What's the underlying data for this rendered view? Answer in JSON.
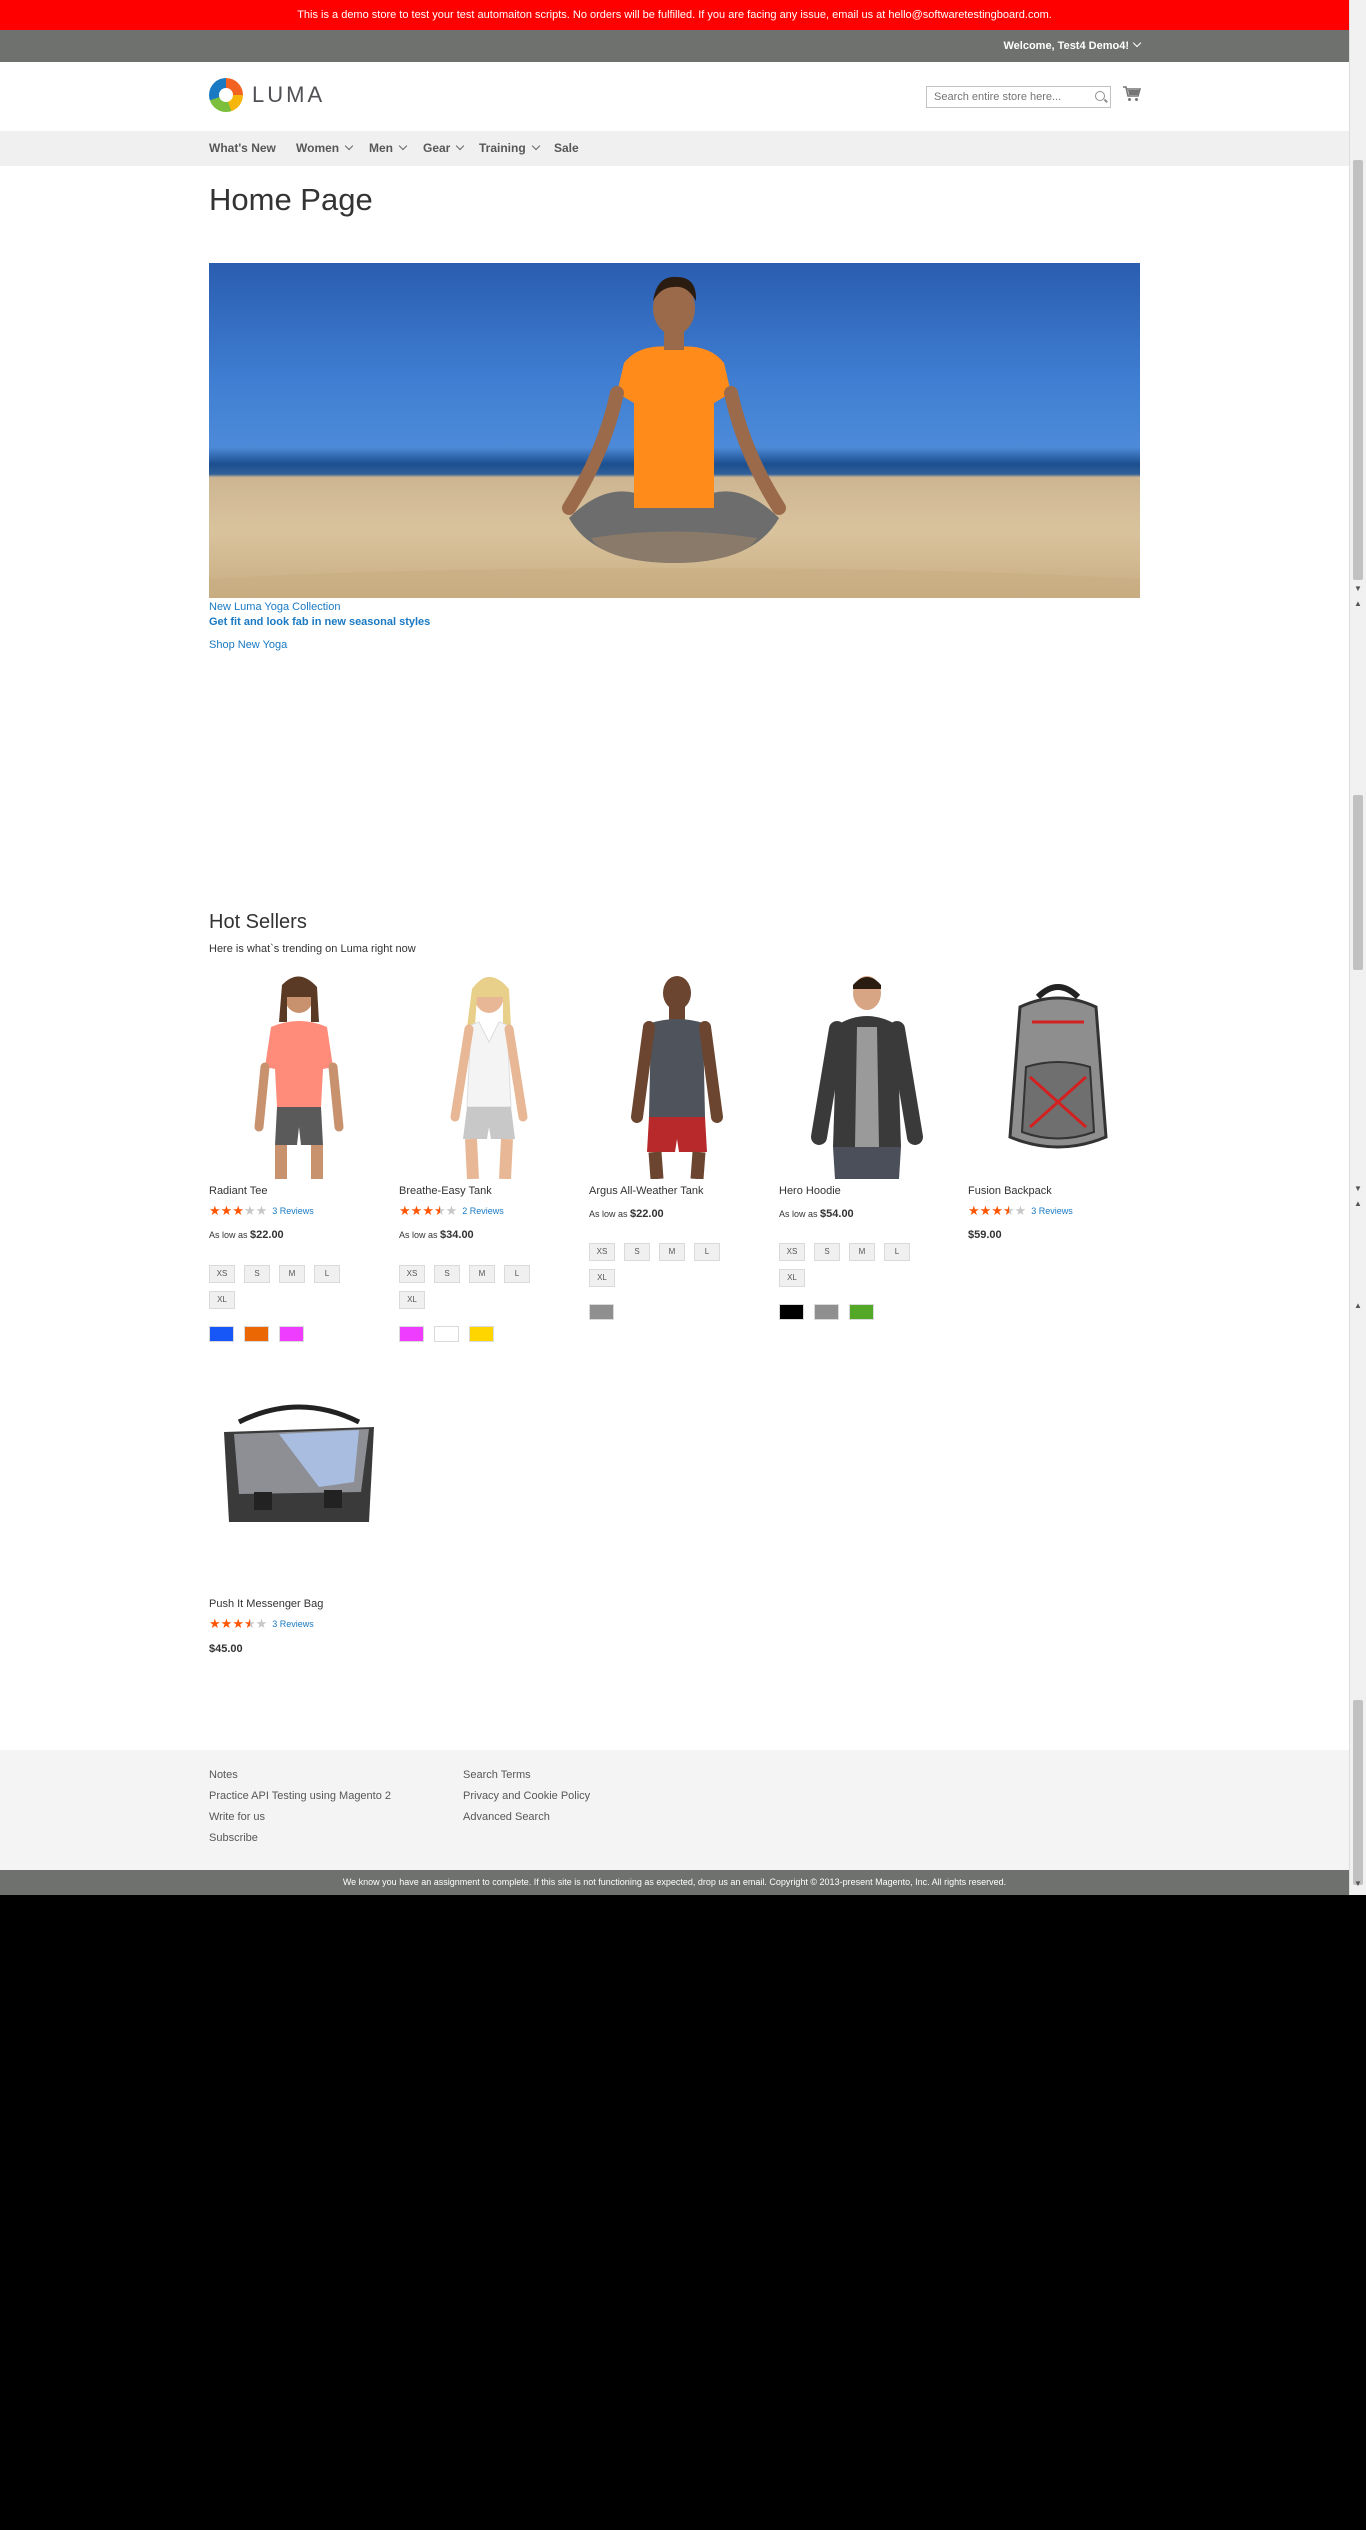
{
  "demo_notice": "This is a demo store to test your test automaiton scripts. No orders will be fulfilled. If you are facing any issue, email us at hello@softwaretestingboard.com.",
  "header": {
    "welcome": "Welcome, Test4 Demo4!",
    "logo_text": "LUMA",
    "search_placeholder": "Search entire store here..."
  },
  "nav": {
    "items": [
      {
        "label": "What's New",
        "dropdown": false
      },
      {
        "label": "Women",
        "dropdown": true
      },
      {
        "label": "Men",
        "dropdown": true
      },
      {
        "label": "Gear",
        "dropdown": true
      },
      {
        "label": "Training",
        "dropdown": true
      },
      {
        "label": "Sale",
        "dropdown": false
      }
    ]
  },
  "page_title": "Home Page",
  "promo": {
    "collection": "New Luma Yoga Collection",
    "tagline": "Get fit and look fab in new seasonal styles",
    "cta": "Shop New Yoga"
  },
  "hot_sellers": {
    "title": "Hot Sellers",
    "subtitle": "Here is what`s trending on Luma right now",
    "products": [
      {
        "name": "Radiant Tee",
        "rating": 3,
        "reviews": "3 Reviews",
        "price_prefix": "As low as",
        "price": "$22.00",
        "sizes": [
          "XS",
          "S",
          "M",
          "L",
          "XL"
        ],
        "colors": [
          "#1857f7",
          "#eb6703",
          "#ef3dff"
        ]
      },
      {
        "name": "Breathe-Easy Tank",
        "rating": 3.5,
        "reviews": "2 Reviews",
        "price_prefix": "As low as",
        "price": "$34.00",
        "sizes": [
          "XS",
          "S",
          "M",
          "L",
          "XL"
        ],
        "colors": [
          "#ef3dff",
          "#ffffff",
          "#ffd500"
        ]
      },
      {
        "name": "Argus All-Weather Tank",
        "rating": 0,
        "reviews": "",
        "price_prefix": "As low as",
        "price": "$22.00",
        "sizes": [
          "XS",
          "S",
          "M",
          "L",
          "XL"
        ],
        "colors": [
          "#8f8f8f"
        ]
      },
      {
        "name": "Hero Hoodie",
        "rating": 0,
        "reviews": "",
        "price_prefix": "As low as",
        "price": "$54.00",
        "sizes": [
          "XS",
          "S",
          "M",
          "L",
          "XL"
        ],
        "colors": [
          "#000000",
          "#8f8f8f",
          "#53a828"
        ]
      },
      {
        "name": "Fusion Backpack",
        "rating": 3.5,
        "reviews": "3 Reviews",
        "price_prefix": "",
        "price": "$59.00",
        "sizes": [],
        "colors": []
      },
      {
        "name": "Push It Messenger Bag",
        "rating": 3.5,
        "reviews": "3 Reviews",
        "price_prefix": "",
        "price": "$45.00",
        "sizes": [],
        "colors": []
      }
    ]
  },
  "footer": {
    "col1": [
      "Notes",
      "Practice API Testing using Magento 2",
      "Write for us",
      "Subscribe"
    ],
    "col2": [
      "Search Terms",
      "Privacy and Cookie Policy",
      "Advanced Search"
    ],
    "copyright": "We know you have an assignment to complete. If this site is not functioning as expected, drop us an email. Copyright © 2013-present Magento, Inc. All rights reserved."
  }
}
